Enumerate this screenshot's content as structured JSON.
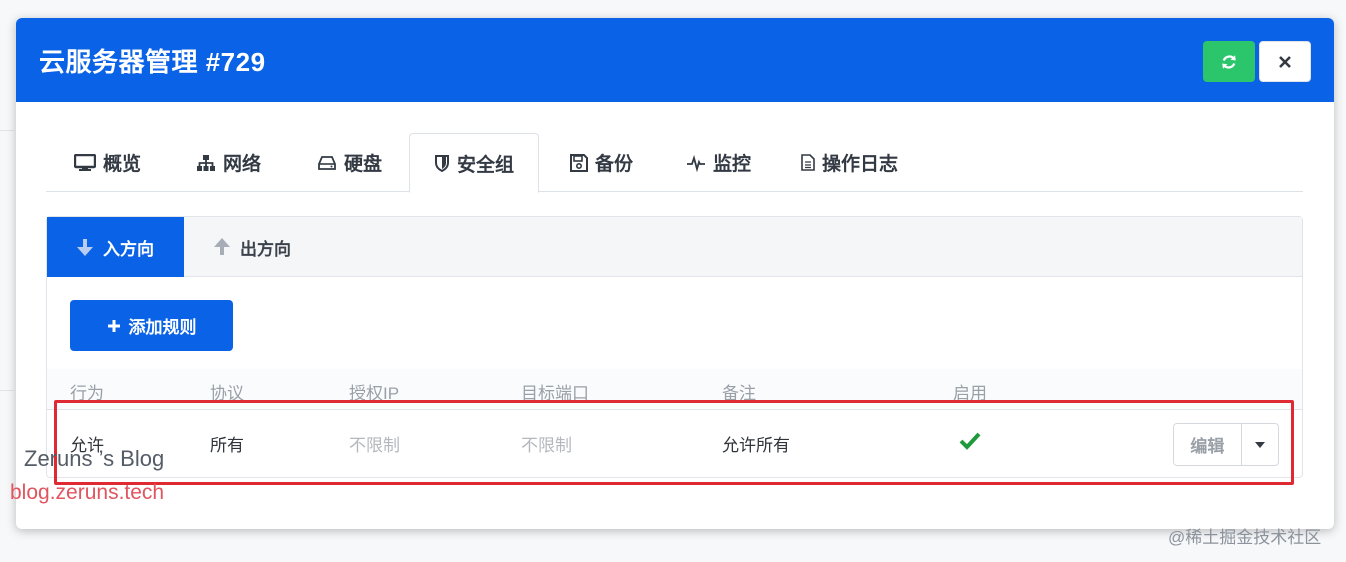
{
  "modal": {
    "title": "云服务器管理 #729"
  },
  "tabs": [
    {
      "label": "概览",
      "icon": "monitor-icon"
    },
    {
      "label": "网络",
      "icon": "sitemap-icon"
    },
    {
      "label": "硬盘",
      "icon": "hdd-icon"
    },
    {
      "label": "安全组",
      "icon": "shield-icon",
      "active": true
    },
    {
      "label": "备份",
      "icon": "save-icon"
    },
    {
      "label": "监控",
      "icon": "heartbeat-icon"
    },
    {
      "label": "操作日志",
      "icon": "file-icon"
    }
  ],
  "direction_tabs": [
    {
      "label": "入方向",
      "icon": "arrow-down-icon",
      "active": true
    },
    {
      "label": "出方向",
      "icon": "arrow-up-icon"
    }
  ],
  "add_rule_label": "添加规则",
  "table": {
    "columns": [
      "行为",
      "协议",
      "授权IP",
      "目标端口",
      "备注",
      "启用"
    ],
    "rows": [
      {
        "action": "允许",
        "protocol": "所有",
        "ip": "不限制",
        "port": "不限制",
        "remark": "允许所有",
        "enabled": true
      }
    ],
    "edit_label": "编辑"
  },
  "watermark": {
    "name": "Zeruns ’s Blog",
    "url": "blog.zeruns.tech",
    "corner": "@稀土掘金技术社区"
  },
  "colors": {
    "primary": "#0a62e6",
    "success": "#2bc66c",
    "check": "#1e9a3c",
    "highlight": "#e02a33"
  }
}
